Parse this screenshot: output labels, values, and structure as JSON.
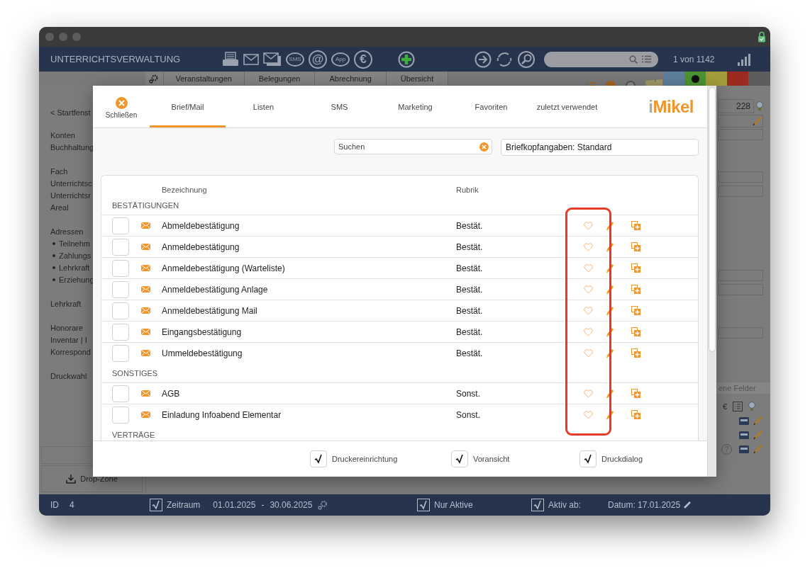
{
  "header": {
    "title": "UNTERRICHTSVERWALTUNG",
    "tools": [
      {
        "kind": "printer"
      },
      {
        "kind": "mail"
      },
      {
        "kind": "mail-stack"
      },
      {
        "kind": "bubble",
        "label": "SMS"
      },
      {
        "kind": "glyph",
        "label": "@"
      },
      {
        "kind": "bubble",
        "label": "App"
      },
      {
        "kind": "glyph",
        "label": "€"
      },
      {
        "kind": "add"
      }
    ],
    "nav_tools": [
      {
        "kind": "arrow"
      },
      {
        "kind": "refresh"
      },
      {
        "kind": "search"
      }
    ],
    "record_count": "1 von 1142"
  },
  "tab_strip": {
    "tabs": [
      "Veranstaltungen",
      "Belegungen",
      "Abrechnung",
      "Übersicht"
    ],
    "swatches": [
      {
        "color": "#5f809c",
        "selected": false
      },
      {
        "color": "#4d9434",
        "selected": true
      },
      {
        "color": "#a49d3b",
        "selected": false
      },
      {
        "color": "#9c2a20",
        "selected": false
      },
      {
        "color": "#5d5d5d",
        "selected": false
      }
    ]
  },
  "sidebar": {
    "groups": [
      {
        "items": [
          {
            "label": "< Startfenst",
            "bullet": false
          }
        ]
      },
      {
        "items": [
          {
            "label": "Konten",
            "bullet": false
          },
          {
            "label": "Buchhaltung",
            "bullet": false
          }
        ]
      },
      {
        "items": [
          {
            "label": "Fach",
            "bullet": false
          },
          {
            "label": "Unterrichtsc",
            "bullet": false
          },
          {
            "label": "Unterrichtsr",
            "bullet": false
          },
          {
            "label": "Areal",
            "bullet": false
          }
        ]
      },
      {
        "items": [
          {
            "label": "Adressen",
            "bullet": false
          },
          {
            "label": "Teilnehm",
            "bullet": true
          },
          {
            "label": "Zahlungs",
            "bullet": true
          },
          {
            "label": "Lehrkraft",
            "bullet": true
          },
          {
            "label": "Erziehung",
            "bullet": true
          }
        ]
      },
      {
        "items": [
          {
            "label": "Lehrkraft",
            "bullet": false
          }
        ]
      },
      {
        "items": [
          {
            "label": "Honorare",
            "bullet": false
          },
          {
            "label": "Inventar | I",
            "bullet": false
          },
          {
            "label": "Korrespond",
            "bullet": false
          }
        ]
      },
      {
        "items": [
          {
            "label": "Druckwahl",
            "bullet": false
          }
        ]
      }
    ]
  },
  "drop_zone": {
    "label": "Drop-Zone"
  },
  "right_panel": {
    "count": "228",
    "section_label": "ene Felder",
    "currency": "€",
    "help": "?"
  },
  "dialog": {
    "close_label": "Schließen",
    "tabs": [
      {
        "label": "Brief/Mail",
        "selected": true
      },
      {
        "label": "Listen",
        "selected": false
      },
      {
        "label": "SMS",
        "selected": false
      },
      {
        "label": "Marketing",
        "selected": false
      },
      {
        "label": "Favoriten",
        "selected": false
      },
      {
        "label": "zuletzt verwendet",
        "selected": false
      }
    ],
    "logo": "iMikel",
    "search": {
      "placeholder": "Suchen"
    },
    "letterhead": {
      "value": "Briefkopfangaben: Standard"
    },
    "table": {
      "columns": [
        "Bezeichnung",
        "Rubrik"
      ],
      "groups": [
        {
          "title": "BESTÄTIGUNGEN",
          "rows": [
            {
              "name": "Abmeldebestätigung",
              "category": "Bestät.",
              "checked": false,
              "favorite": false
            },
            {
              "name": "Anmeldebestätigung",
              "category": "Bestät.",
              "checked": false,
              "favorite": false
            },
            {
              "name": "Anmeldebestätigung (Warteliste)",
              "category": "Bestät.",
              "checked": false,
              "favorite": false
            },
            {
              "name": "Anmeldebestätigung Anlage",
              "category": "Bestät.",
              "checked": false,
              "favorite": false
            },
            {
              "name": "Anmeldebestätigung Mail",
              "category": "Bestät.",
              "checked": false,
              "favorite": false
            },
            {
              "name": "Eingangsbestätigung",
              "category": "Bestät.",
              "checked": false,
              "favorite": false
            },
            {
              "name": "Ummeldebestätigung",
              "category": "Bestät.",
              "checked": false,
              "favorite": false
            }
          ]
        },
        {
          "title": "SONSTIGES",
          "rows": [
            {
              "name": "AGB",
              "category": "Sonst.",
              "checked": false,
              "favorite": false
            },
            {
              "name": "Einladung Infoabend Elementar",
              "category": "Sonst.",
              "checked": false,
              "favorite": false
            }
          ]
        },
        {
          "title": "VERTRÄGE"
        }
      ]
    },
    "options": [
      {
        "label": "Druckereinrichtung",
        "checked": true
      },
      {
        "label": "Voransicht",
        "checked": true
      },
      {
        "label": "Druckdialog",
        "checked": true
      }
    ]
  },
  "status_bar": {
    "id_label": "ID",
    "id": "4",
    "period": {
      "checked": true,
      "label": "Zeitraum",
      "from": "01.01.2025",
      "separator": "-",
      "to": "30.06.2025"
    },
    "active_only": {
      "checked": true,
      "label": "Nur Aktive"
    },
    "active_from": {
      "checked": true,
      "label": "Aktiv ab:"
    },
    "date": "Datum: 17.01.2025"
  }
}
